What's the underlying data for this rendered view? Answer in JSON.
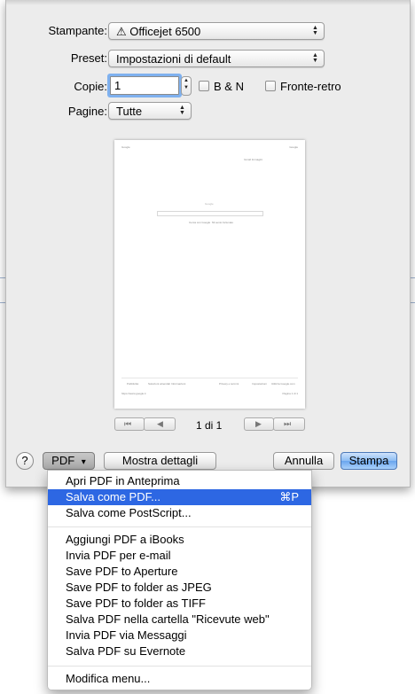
{
  "dialog": {
    "printer_label": "Stampante:",
    "printer_value": "Officejet 6500",
    "printer_warning_icon": "⚠",
    "preset_label": "Preset:",
    "preset_value": "Impostazioni di default",
    "copies_label": "Copie:",
    "copies_value": "1",
    "bw_label": "B & N",
    "duplex_label": "Fronte-retro",
    "pages_label": "Pagine:",
    "pages_value": "Tutte",
    "page_indicator": "1 di 1",
    "nav_first": "⏮",
    "nav_prev": "◀",
    "nav_next": "▶",
    "nav_last": "⏭"
  },
  "preview": {
    "header_left": "Google",
    "header_right": "Google",
    "top_links": "Gmail  Immagini",
    "search_label": "Google",
    "button_search": "Cerca con Google",
    "button_lucky": "Mi sento fortunato",
    "footer_left_1": "Pubblicità",
    "footer_left_2": "Soluzioni aziendali",
    "footer_left_3": "Informazioni",
    "footer_right_1": "Privacy e termini",
    "footer_right_2": "Impostazioni",
    "footer_right_3": "Utilizza Google.com",
    "bottom_left": "https://www.google.it",
    "bottom_right": "Pagina 1 di 1"
  },
  "buttons": {
    "help": "?",
    "pdf": "PDF",
    "pdf_arrow": "▾",
    "details": "Mostra dettagli",
    "cancel": "Annulla",
    "print": "Stampa"
  },
  "menu": {
    "items": [
      {
        "label": "Apri PDF in Anteprima",
        "shortcut": ""
      },
      {
        "label": "Salva come PDF...",
        "shortcut": "⌘P"
      },
      {
        "label": "Salva come PostScript...",
        "shortcut": ""
      },
      {
        "label": "Aggiungi PDF a iBooks",
        "shortcut": ""
      },
      {
        "label": "Invia PDF per e-mail",
        "shortcut": ""
      },
      {
        "label": "Save PDF to Aperture",
        "shortcut": ""
      },
      {
        "label": "Save PDF to folder as JPEG",
        "shortcut": ""
      },
      {
        "label": "Save PDF to folder as TIFF",
        "shortcut": ""
      },
      {
        "label": "Salva PDF nella cartella \"Ricevute web\"",
        "shortcut": ""
      },
      {
        "label": "Invia PDF via Messaggi",
        "shortcut": ""
      },
      {
        "label": "Salva PDF su Evernote",
        "shortcut": ""
      },
      {
        "label": "Modifica menu...",
        "shortcut": ""
      }
    ],
    "highlighted_index": 1,
    "highlight_color": "#2d67e3"
  }
}
